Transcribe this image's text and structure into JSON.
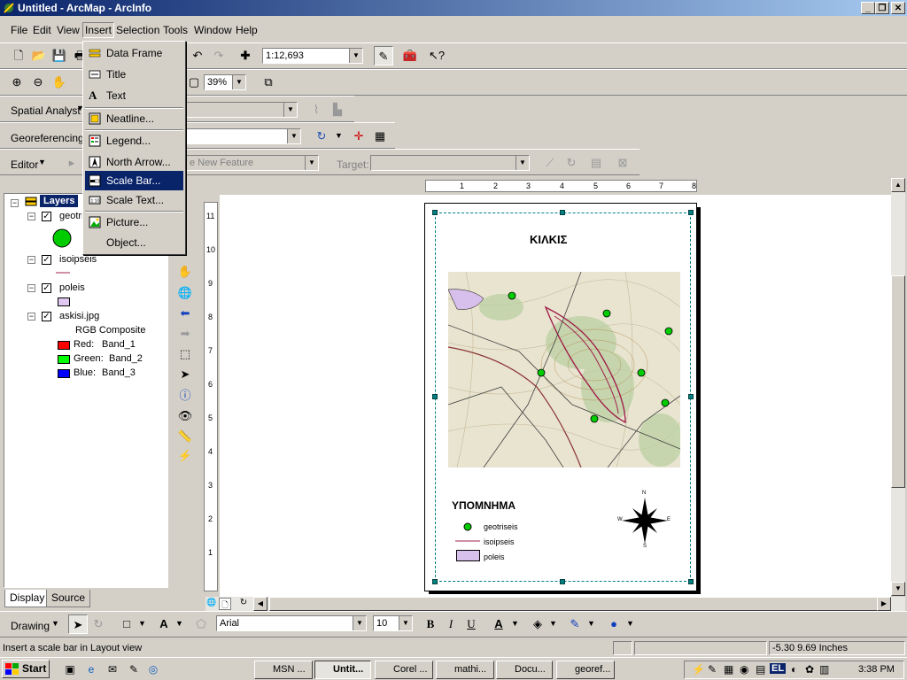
{
  "window": {
    "title": "Untitled - ArcMap - ArcInfo"
  },
  "menubar": {
    "items": [
      "File",
      "Edit",
      "View",
      "Insert",
      "Selection",
      "Tools",
      "Window",
      "Help"
    ]
  },
  "insert_menu": {
    "items": [
      "Data Frame",
      "Title",
      "Text",
      "Neatline...",
      "Legend...",
      "North Arrow...",
      "Scale Bar...",
      "Scale Text...",
      "Picture...",
      "Object..."
    ],
    "highlighted": "Scale Bar..."
  },
  "standard_toolbar": {
    "scale_value": "1:12,693"
  },
  "layout_toolbar": {
    "zoom_value": "39%"
  },
  "spatial_analyst": {
    "label": "Spatial Analyst"
  },
  "georeferencing": {
    "label": "Georeferencing"
  },
  "editor": {
    "label": "Editor",
    "task_value": "e New Feature",
    "target_label": "Target:"
  },
  "toc": {
    "root": "Layers",
    "layers": [
      {
        "name": "geotri",
        "symbol": "green-circle"
      },
      {
        "name": "isoipseis",
        "symbol": "line"
      },
      {
        "name": "poleis",
        "symbol": "polygon"
      },
      {
        "name": "askisi.jpg",
        "symbol": "raster"
      }
    ],
    "raster_legend": {
      "title": "RGB Composite",
      "bands": [
        {
          "label": "Red:",
          "band": "Band_1",
          "color": "#ff0000"
        },
        {
          "label": "Green:",
          "band": "Band_2",
          "color": "#00ff00"
        },
        {
          "label": "Blue:",
          "band": "Band_3",
          "color": "#0000ff"
        }
      ]
    },
    "tabs": [
      "Display",
      "Source"
    ]
  },
  "ruler": {
    "h_ticks": [
      "1",
      "2",
      "3",
      "4",
      "5",
      "6",
      "7",
      "8"
    ],
    "v_ticks": [
      "11",
      "10",
      "9",
      "8",
      "7",
      "6",
      "5",
      "4",
      "3",
      "2",
      "1"
    ]
  },
  "map_layout": {
    "title": "ΚΙΛΚΙΣ",
    "legend_title": "ΥΠΟΜΝΗΜΑ",
    "legend_items": [
      {
        "label": "geotriseis",
        "symbol": "point"
      },
      {
        "label": "isoipseis",
        "symbol": "line"
      },
      {
        "label": "poleis",
        "symbol": "polygon"
      }
    ],
    "north_arrow_letters": {
      "n": "N",
      "e": "E",
      "s": "S",
      "w": "W"
    }
  },
  "drawing_toolbar": {
    "label": "Drawing",
    "font": "Arial",
    "size": "10",
    "bold": "B",
    "italic": "I",
    "underline": "U"
  },
  "status": {
    "message": "Insert a scale bar in Layout view",
    "coords": "-5.30  9.69 Inches"
  },
  "taskbar": {
    "start": "Start",
    "tasks": [
      "MSN ...",
      "Untit...",
      "Corel ...",
      "mathi...",
      "Docu...",
      "georef..."
    ],
    "active": "Untit...",
    "tray_lang": "EL",
    "clock": "3:38 PM"
  },
  "colors": {
    "title_start": "#0a246a",
    "title_end": "#a6caf0",
    "highlight": "#0a246a",
    "point": "#00cc00"
  }
}
